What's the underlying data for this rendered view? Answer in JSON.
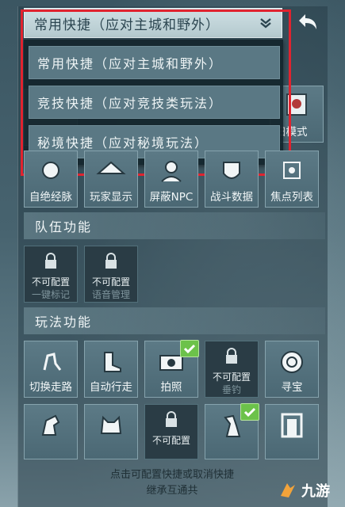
{
  "header": {
    "title": "常用快捷（应对主城和野外）",
    "dropdown_icon": "chevron-down-icon",
    "back_icon": "back-arrow-icon"
  },
  "dropdown": {
    "options": [
      "常用快捷（应对主城和野外）",
      "竞技快捷（应对竞技类玩法）",
      "秘境快捷（应对秘境玩法）"
    ],
    "highlight_color": "#e0232f"
  },
  "top_tiles": {
    "partial_label": "旧模式",
    "row": [
      "自绝经脉",
      "玩家显示",
      "屏蔽NPC",
      "战斗数据",
      "焦点列表"
    ]
  },
  "team_section": {
    "title": "队伍功能",
    "tiles": [
      {
        "status": "不可配置",
        "label": "一键标记"
      },
      {
        "status": "不可配置",
        "label": "语音管理"
      }
    ]
  },
  "play_section": {
    "title": "玩法功能",
    "row1": [
      {
        "label": "切换走路"
      },
      {
        "label": "自动行走"
      },
      {
        "label": "拍照",
        "checked": true
      },
      {
        "status": "不可配置",
        "label": "垂钓"
      },
      {
        "label": "寻宝"
      }
    ],
    "row2_status": "不可配置"
  },
  "hint": {
    "line1": "点击可配置快捷或取消快捷",
    "line2": "继承互通共"
  },
  "watermark": {
    "text": "九游"
  },
  "colors": {
    "check": "#6cc24a",
    "panel": "#3d5763"
  }
}
